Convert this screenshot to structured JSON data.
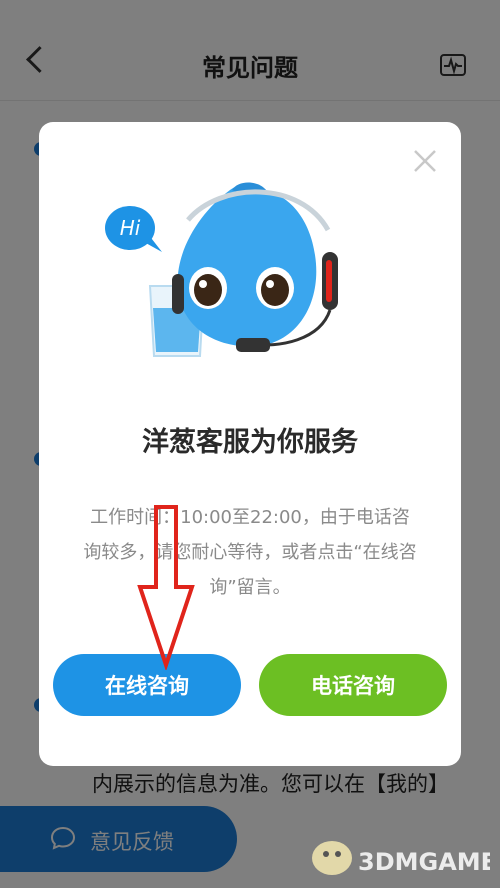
{
  "header": {
    "title": "常见问题"
  },
  "page": {
    "partial_text": "内展示的信息为准。您可以在【我的】"
  },
  "feedback": {
    "label": "意见反馈"
  },
  "dialog": {
    "title": "洋葱客服为你服务",
    "description": "工作时间：10:00至22:00，由于电话咨询较多，请您耐心等待，或者点击“在线咨询”留言。",
    "bubble_text": "Hi",
    "online_button": "在线咨询",
    "phone_button": "电话咨询"
  },
  "watermark": {
    "text": "3DMGAME"
  },
  "colors": {
    "primary_blue": "#1e93e5",
    "green": "#6cbf23",
    "arrow_red": "#e0241b"
  }
}
